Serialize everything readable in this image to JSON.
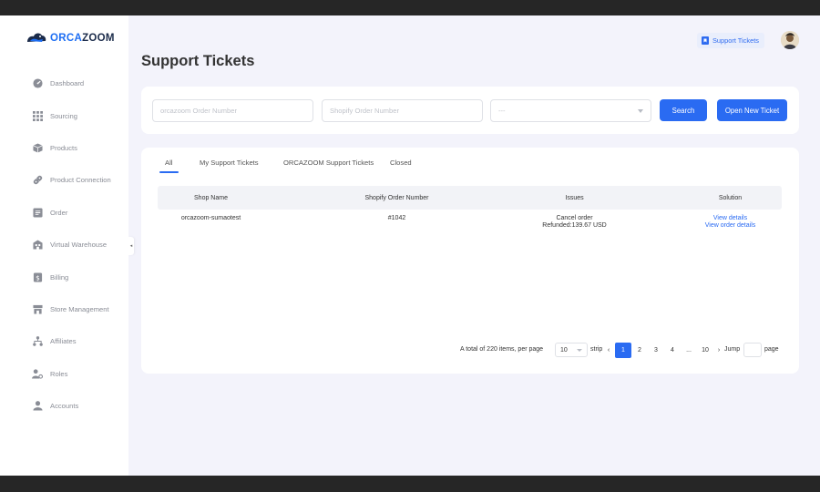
{
  "brand": {
    "logo_part1": "ORCA",
    "logo_part2": "ZOOM",
    "accent": "#2a6bf2",
    "dark": "#1b2b4a"
  },
  "sidebar": {
    "items": [
      {
        "label": "Dashboard",
        "icon": "dashboard-icon"
      },
      {
        "label": "Sourcing",
        "icon": "grid-icon"
      },
      {
        "label": "Products",
        "icon": "box-icon"
      },
      {
        "label": "Product Connection",
        "icon": "link-icon"
      },
      {
        "label": "Order",
        "icon": "order-list-icon"
      },
      {
        "label": "Virtual Warehouse",
        "icon": "warehouse-icon"
      },
      {
        "label": "Billing",
        "icon": "billing-icon"
      },
      {
        "label": "Store Management",
        "icon": "store-icon"
      },
      {
        "label": "Affiliates",
        "icon": "affiliates-icon"
      },
      {
        "label": "Roles",
        "icon": "roles-icon"
      },
      {
        "label": "Accounts",
        "icon": "account-icon"
      }
    ],
    "collapse_glyph": "◂"
  },
  "header": {
    "title": "Support Tickets",
    "support_link": "Support Tickets"
  },
  "filters": {
    "order_number_placeholder": "orcazoom Order Number",
    "shopify_order_placeholder": "Shopify Order Number",
    "select_value": "---",
    "search_label": "Search",
    "open_ticket_label": "Open New Ticket"
  },
  "tabs": [
    "All",
    "My Support Tickets",
    "ORCAZOOM Support Tickets",
    "Closed"
  ],
  "table": {
    "columns": [
      "Shop Name",
      "Shopify Order Number",
      "Issues",
      "Solution"
    ],
    "rows": [
      {
        "shop_name": "orcazoom-sumaotest",
        "shopify_order": "#1042",
        "issue_line1": "Cancel order",
        "issue_line2": "Refunded:139.67 USD",
        "solution_link1": "View details",
        "solution_link2": "View order details"
      }
    ]
  },
  "pagination": {
    "total_text": "A total of 220 items, per page",
    "per_page": "10",
    "strip_text": "strip",
    "prev": "‹",
    "pages": [
      "1",
      "2",
      "3",
      "4",
      "...",
      "10"
    ],
    "next": "›",
    "jump_label": "Jump",
    "page_label": "page",
    "current": "1"
  }
}
